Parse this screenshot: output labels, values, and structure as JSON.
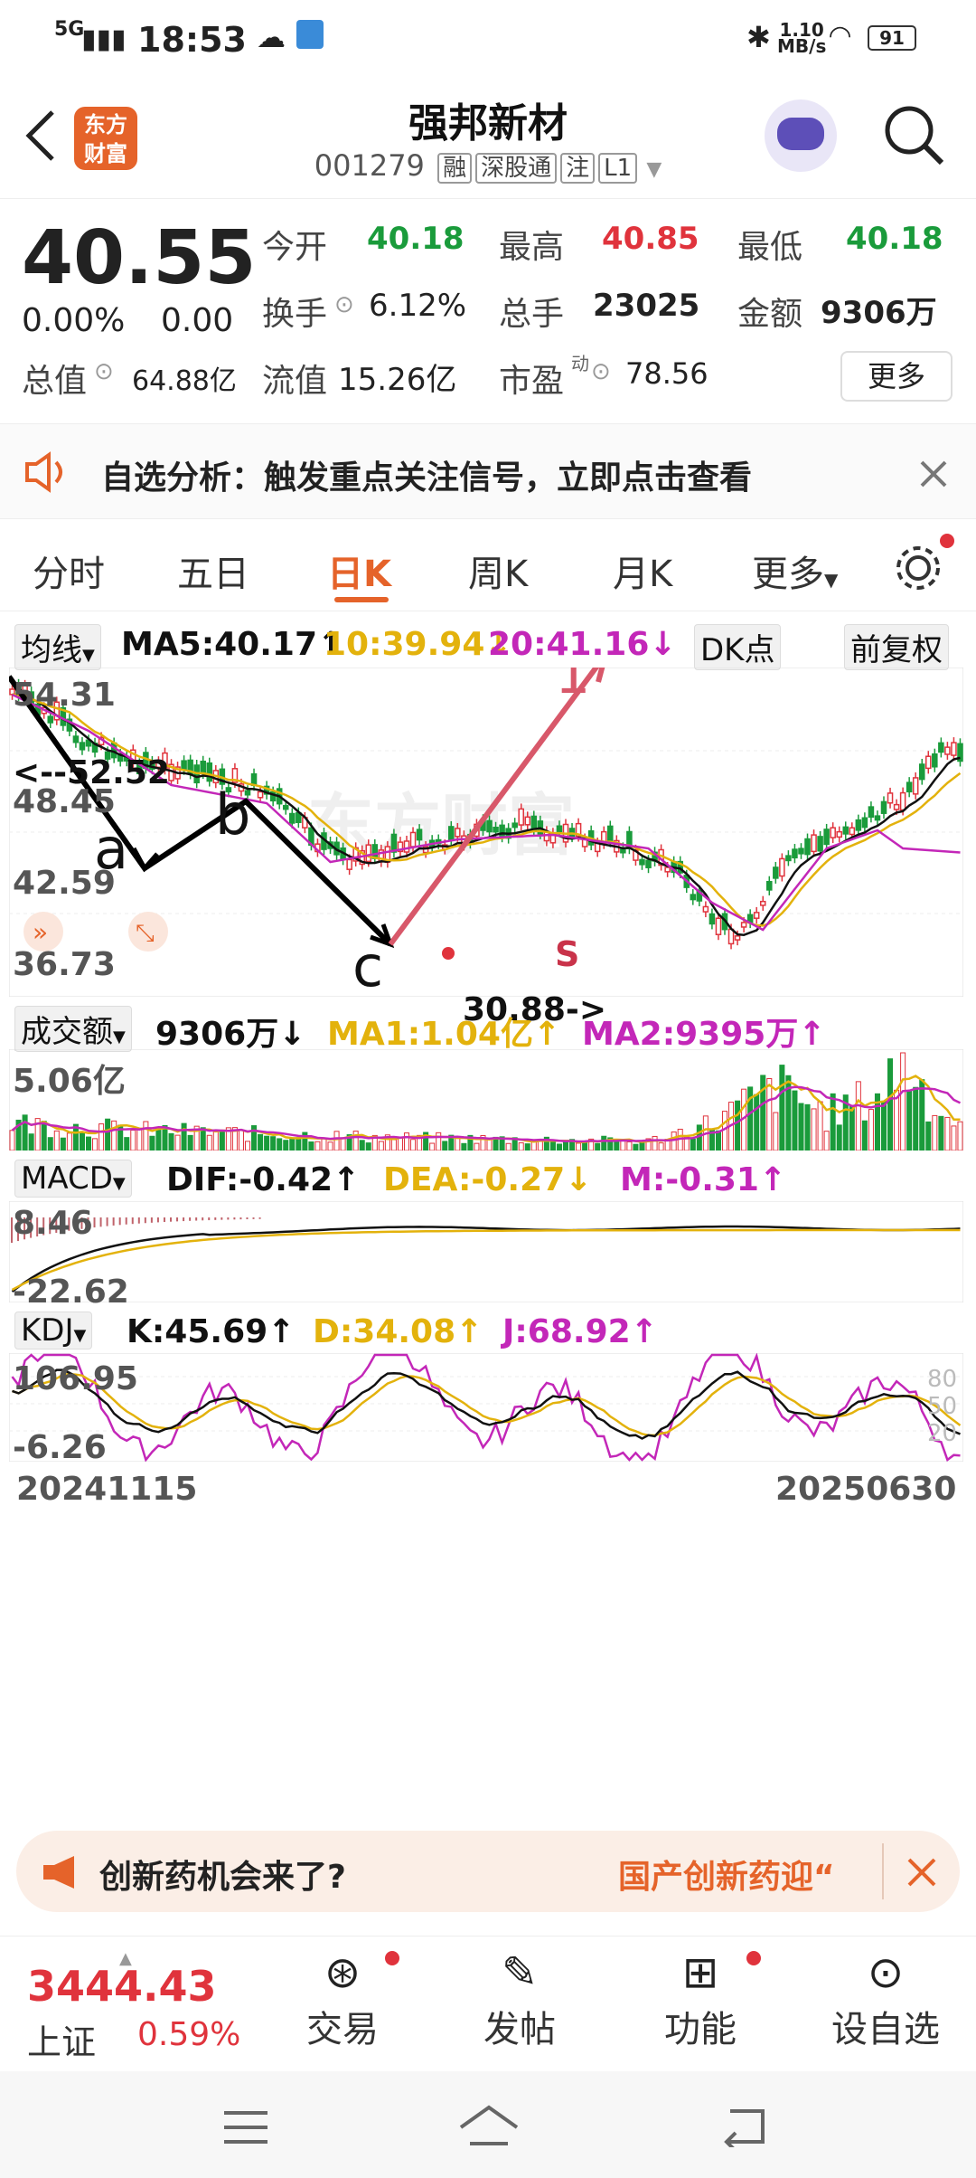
{
  "status_bar": {
    "time": "18:53",
    "net": "5G",
    "speed": "1.10",
    "speed_unit": "MB/s",
    "battery": "91"
  },
  "header": {
    "name": "强邦新材",
    "code": "001279",
    "tags": [
      "融",
      "深股通",
      "注",
      "L1"
    ]
  },
  "logo_text": "东方财富",
  "quote": {
    "price": "40.55",
    "change_pct": "0.00%",
    "change": "0.00",
    "open_label": "今开",
    "open": "40.18",
    "high_label": "最高",
    "high": "40.85",
    "low_label": "最低",
    "low": "40.18",
    "turnover_label": "换手",
    "turnover": "6.12%",
    "volume_label": "总手",
    "volume": "23025",
    "amount_label": "金额",
    "amount": "9306万",
    "mktcap_label": "总值",
    "mktcap": "64.88亿",
    "float_label": "流值",
    "float": "15.26亿",
    "pe_label": "市盈",
    "pe_sup": "动",
    "pe": "78.56",
    "more_label": "更多"
  },
  "notice": {
    "text": "自选分析：触发重点关注信号，立即点击查看"
  },
  "tabs": [
    "分时",
    "五日",
    "日K",
    "周K",
    "月K",
    "更多"
  ],
  "active_tab": "日K",
  "ma_row": {
    "selector": "均线",
    "ma5": "MA5:40.17↑",
    "ma10": "10:39.94↓",
    "ma20": "20:41.16↓",
    "dk": "DK点",
    "fq": "前复权"
  },
  "price_axis": {
    "max": "54.31",
    "l2": "48.45",
    "l3": "42.59",
    "l4": "36.73",
    "min": "30.88",
    "hi_mark": "<--52.52",
    "lo_mark": "30.88->"
  },
  "annotations": {
    "a": "a",
    "b": "b",
    "c": "c",
    "one": "1",
    "s": "S"
  },
  "vol_row": {
    "selector": "成交额",
    "val": "9306万↓",
    "ma1": "MA1:1.04亿↑",
    "ma2": "MA2:9395万↑",
    "max": "5.06亿"
  },
  "macd_row": {
    "selector": "MACD",
    "dif": "DIF:-0.42↑",
    "dea": "DEA:-0.27↓",
    "m": "M:-0.31↑",
    "max": "8.46",
    "min": "-22.62"
  },
  "kdj_row": {
    "selector": "KDJ",
    "k": "K:45.69↑",
    "d": "D:34.08↑",
    "j": "J:68.92↑",
    "max": "106.95",
    "min": "-6.26",
    "r80": "80",
    "r50": "50",
    "r20": "20"
  },
  "dates": {
    "start": "20241115",
    "end": "20250630"
  },
  "watermark": "东方财富",
  "banner": {
    "left": "创新药机会来了?",
    "right": "国产创新药迎“"
  },
  "index": {
    "value": "3444.43",
    "name": "上证",
    "pct": "0.59%"
  },
  "nav": [
    "交易",
    "发帖",
    "功能",
    "设自选"
  ],
  "colors": {
    "up": "#e0333c",
    "down": "#1a9b3b",
    "accent": "#e5632a",
    "ma10": "#e3b20c",
    "ma20": "#c327b8"
  }
}
